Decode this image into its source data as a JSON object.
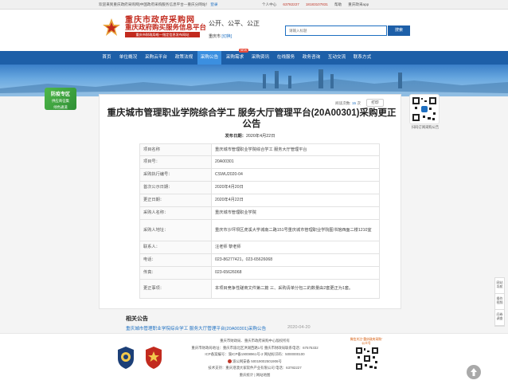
{
  "topbar": {
    "welcome": "欢迎来到重庆政府采购网|中国政府采购服务信息平台—重庆分网站！",
    "login": "登录",
    "personal": "个人中心",
    "phone": "63782227",
    "phone2": "18183107831",
    "help": "帮助",
    "app": "重庆政采app"
  },
  "header": {
    "logo_line1": "重庆市政府采购网",
    "logo_line2": "重庆政府购买服务信息平台",
    "logo_line3": "重庆市财政局唯一指定信息发布网站",
    "slogan": "公开、公平、公正",
    "region_label": "重庆市",
    "region_switch": "[切换",
    "search_placeholder": "请输入标题",
    "search_button": "搜索"
  },
  "nav": {
    "items": [
      {
        "label": "首页"
      },
      {
        "label": "单位概况"
      },
      {
        "label": "采购云平台"
      },
      {
        "label": "政策法规"
      },
      {
        "label": "采购公告"
      },
      {
        "label": "采购需求"
      },
      {
        "label": "采购资讯"
      },
      {
        "label": "在线服务"
      },
      {
        "label": "政务咨询"
      },
      {
        "label": "互动交流"
      },
      {
        "label": "联系方式"
      }
    ],
    "badge": "NEW"
  },
  "promo": {
    "title": "防疫专区",
    "line1": "供应商征集",
    "line2": "绿色通道"
  },
  "side_qr_caption": "扫码订阅采购公告",
  "article": {
    "view_label": "阅读次数:",
    "view_count": "15",
    "view_unit": "次",
    "print": "打印",
    "title": "重庆城市管理职业学院综合学工 服务大厅管理平台(20A00301)采购更正公告",
    "pubdate_label": "发布日期：",
    "pubdate": "2020年4月22日",
    "rows": [
      {
        "k": "项目名称",
        "v": "重庆城市管理职业学院综合学工 服务大厅管理平台"
      },
      {
        "k": "项目号：",
        "v": "20A00301"
      },
      {
        "k": "采购执行编号：",
        "v": "CSWU2020-04"
      },
      {
        "k": "首次公示日期：",
        "v": "2020年4月20日"
      },
      {
        "k": "更正日期：",
        "v": "2020年4月22日"
      },
      {
        "k": "采购人名称：",
        "v": "重庆城市管理职业学院"
      },
      {
        "k": "采购人地址：",
        "v": "重庆市沙坪坝区虎溪大学城南二路151号重庆城市管理职业学院图书馆西面二楼1210室"
      },
      {
        "k": "联系人：",
        "v": "汪老师 黎老师"
      },
      {
        "k": "电话：",
        "v": "023-86277421，023-65626068"
      },
      {
        "k": "传真：",
        "v": "023-65626068"
      },
      {
        "k": "更正事项：",
        "v": "本项目竞争性磋商文件第二篇 三、采购清单分包二的数量由2套更正为1套。"
      }
    ]
  },
  "related": {
    "title": "相关公告",
    "items": [
      {
        "text": "重庆城市管理职业学院综合学工 服务大厅管理平台(20A00301)采购公告",
        "date": "2020-04-20"
      }
    ]
  },
  "footer": {
    "line1": "重庆市财政局、重庆市政府采购中心版权所有",
    "line2": "重庆市财政局地址：重庆市渝北区洪湖西路1号   重庆市财政局联系电话：67575332",
    "line3": "ICP备案编号：渝ICP备19008961号-2  网站标识码：5000000100",
    "line4": "渝公网安备 50019002501906号",
    "line5": "技术支持：重庆港澳大家软件产业有限公司 电话：63782227",
    "line6": "重庆统计  |  网站地图",
    "qr_caption": "微信关注“重庆政府采购”",
    "qr_caption2": "公众号"
  },
  "tools": [
    "网站导航",
    "操作视频",
    "问卷调查"
  ],
  "colors": {
    "brand_red": "#c22a1e",
    "nav_blue": "#1d5fa8",
    "nav_active": "#3b8fe0",
    "link_blue": "#1d6fc1"
  }
}
